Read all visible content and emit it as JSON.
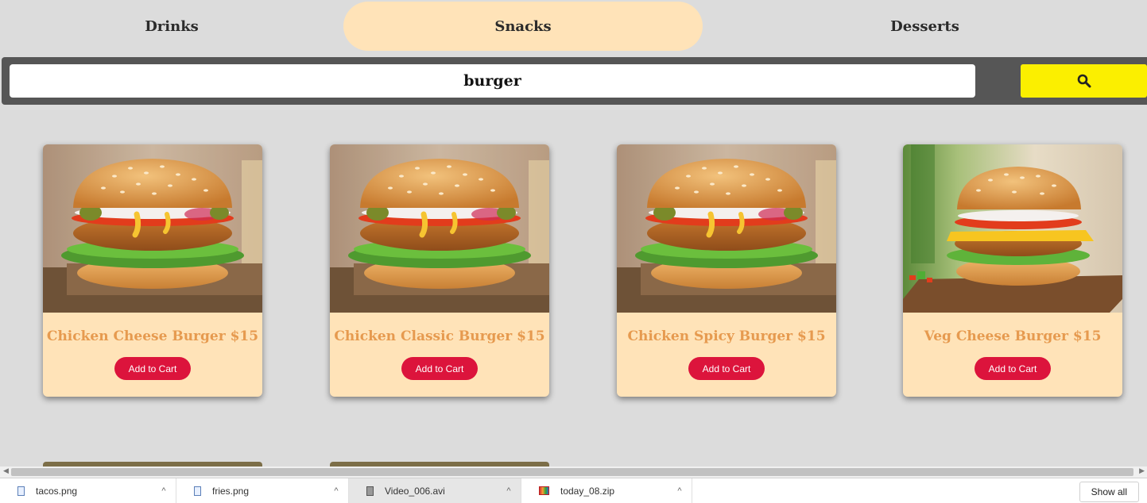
{
  "tabs": [
    {
      "label": "Drinks"
    },
    {
      "label": "Snacks",
      "active": true
    },
    {
      "label": "Desserts"
    }
  ],
  "search": {
    "value": "burger",
    "button_icon": "search-icon"
  },
  "cards": [
    {
      "title": "Chicken Cheese Burger $15",
      "button": "Add to Cart"
    },
    {
      "title": "Chicken Classic Burger $15",
      "button": "Add to Cart"
    },
    {
      "title": "Chicken Spicy Burger $15",
      "button": "Add to Cart"
    },
    {
      "title": "Veg Cheese Burger $15",
      "button": "Add to Cart"
    }
  ],
  "downloads": {
    "items": [
      {
        "name": "tacos.png",
        "icon": "image-file-icon"
      },
      {
        "name": "fries.png",
        "icon": "image-file-icon"
      },
      {
        "name": "Video_006.avi",
        "icon": "video-file-icon"
      },
      {
        "name": "today_08.zip",
        "icon": "zip-file-icon"
      }
    ],
    "show_all": "Show all"
  },
  "colors": {
    "tab_active": "#ffe3b8",
    "search_button": "#fbef00",
    "card_bg": "#ffe3b8",
    "card_title": "#e69a4f",
    "cart_button": "#dc143c"
  }
}
